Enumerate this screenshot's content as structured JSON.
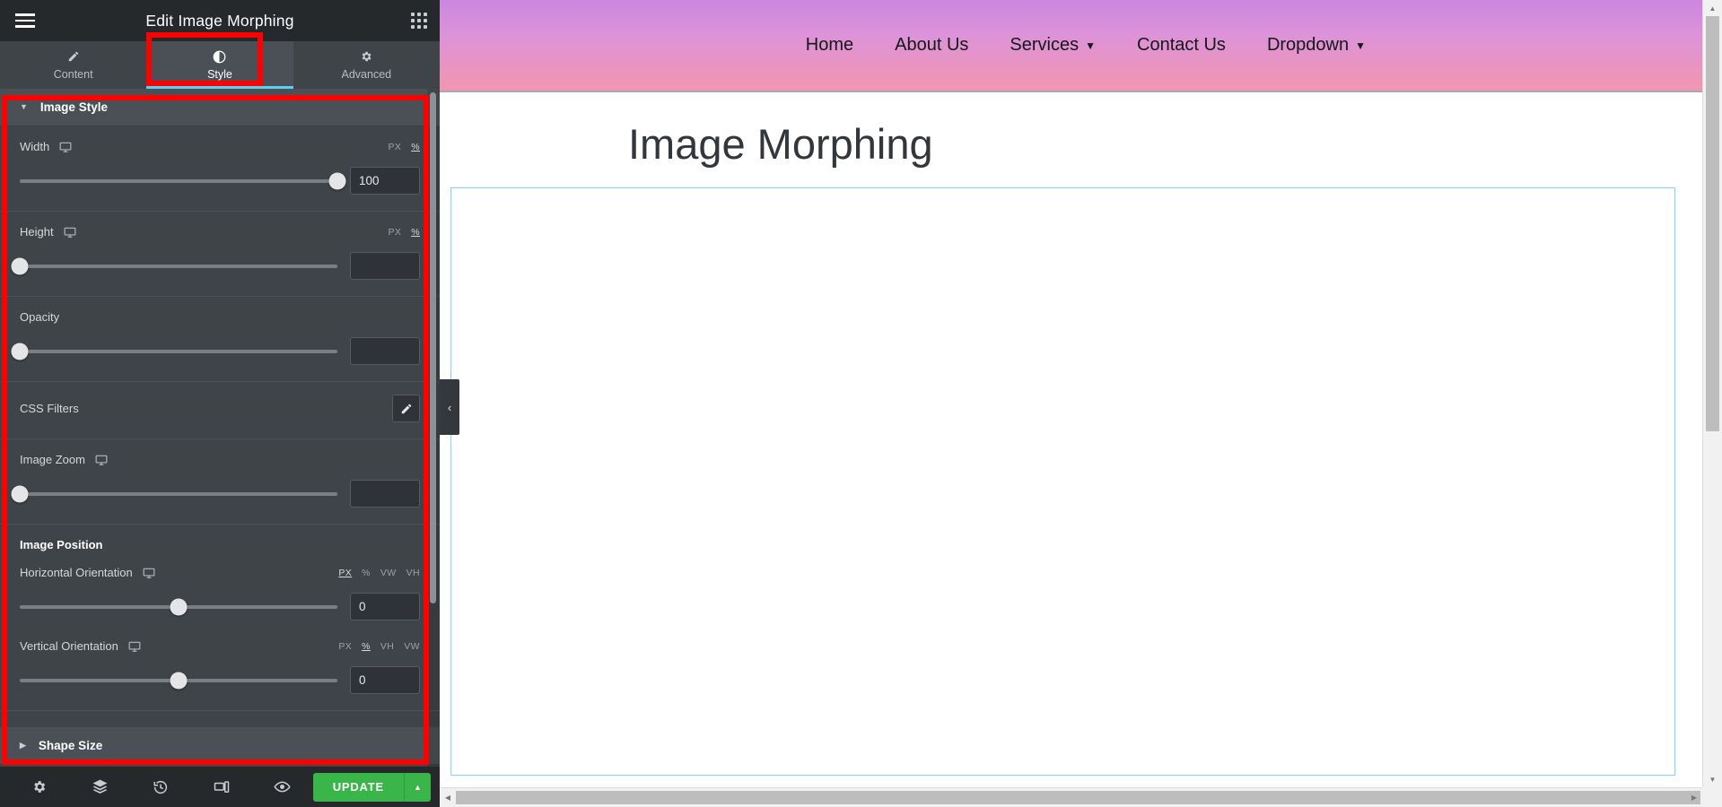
{
  "panel": {
    "title": "Edit Image Morphing",
    "menu_icon": "hamburger-icon",
    "apps_icon": "grid-apps-icon",
    "tabs": [
      {
        "label": "Content",
        "icon": "pencil-icon",
        "active": false
      },
      {
        "label": "Style",
        "icon": "contrast-icon",
        "active": true
      },
      {
        "label": "Advanced",
        "icon": "gear-icon",
        "active": false
      }
    ],
    "sections": [
      {
        "label": "Image Style",
        "expanded": true
      },
      {
        "label": "Shape Size",
        "expanded": false
      }
    ],
    "controls": {
      "width": {
        "label": "Width",
        "units": [
          "PX",
          "%"
        ],
        "active_unit": "%",
        "value": "100",
        "slider_percent": 100
      },
      "height": {
        "label": "Height",
        "units": [
          "PX",
          "%"
        ],
        "active_unit": "%",
        "value": "",
        "slider_percent": 0
      },
      "opacity": {
        "label": "Opacity",
        "units": [],
        "value": "",
        "slider_percent": 0
      },
      "css_filters": {
        "label": "CSS Filters",
        "edit_icon": "pencil-edit-icon"
      },
      "image_zoom": {
        "label": "Image Zoom",
        "units": [],
        "value": "",
        "slider_percent": 0
      },
      "image_position_heading": "Image Position",
      "horizontal_orientation": {
        "label": "Horizontal Orientation",
        "units": [
          "PX",
          "%",
          "VW",
          "VH"
        ],
        "active_unit": "PX",
        "value": "0",
        "slider_percent": 50
      },
      "vertical_orientation": {
        "label": "Vertical Orientation",
        "units": [
          "PX",
          "%",
          "VH",
          "VW"
        ],
        "active_unit": "%",
        "value": "0",
        "slider_percent": 50
      }
    },
    "footer": {
      "icons": [
        {
          "name": "settings-gear-icon",
          "glyph": "⚙"
        },
        {
          "name": "navigator-layers-icon",
          "glyph": "≣"
        },
        {
          "name": "history-icon",
          "glyph": "↺"
        },
        {
          "name": "responsive-mode-icon",
          "glyph": "▭"
        },
        {
          "name": "preview-eye-icon",
          "glyph": "◉"
        }
      ],
      "update_label": "UPDATE",
      "update_arrow": "▲",
      "update_color": "#39b54a"
    },
    "collapse_handle": "‹"
  },
  "preview": {
    "nav": [
      {
        "label": "Home",
        "has_dropdown": false
      },
      {
        "label": "About Us",
        "has_dropdown": false
      },
      {
        "label": "Services",
        "has_dropdown": true
      },
      {
        "label": "Contact Us",
        "has_dropdown": false
      },
      {
        "label": "Dropdown",
        "has_dropdown": true
      }
    ],
    "page_title": "Image Morphing",
    "header_gradient_top": "#cb87e0",
    "header_gradient_bottom": "#f295b0",
    "canvas_border_color": "#7fd8f2"
  },
  "annotations": {
    "highlight_color": "#fe0000",
    "boxes": [
      "style-tab-highlight",
      "image-style-panel-highlight"
    ]
  }
}
